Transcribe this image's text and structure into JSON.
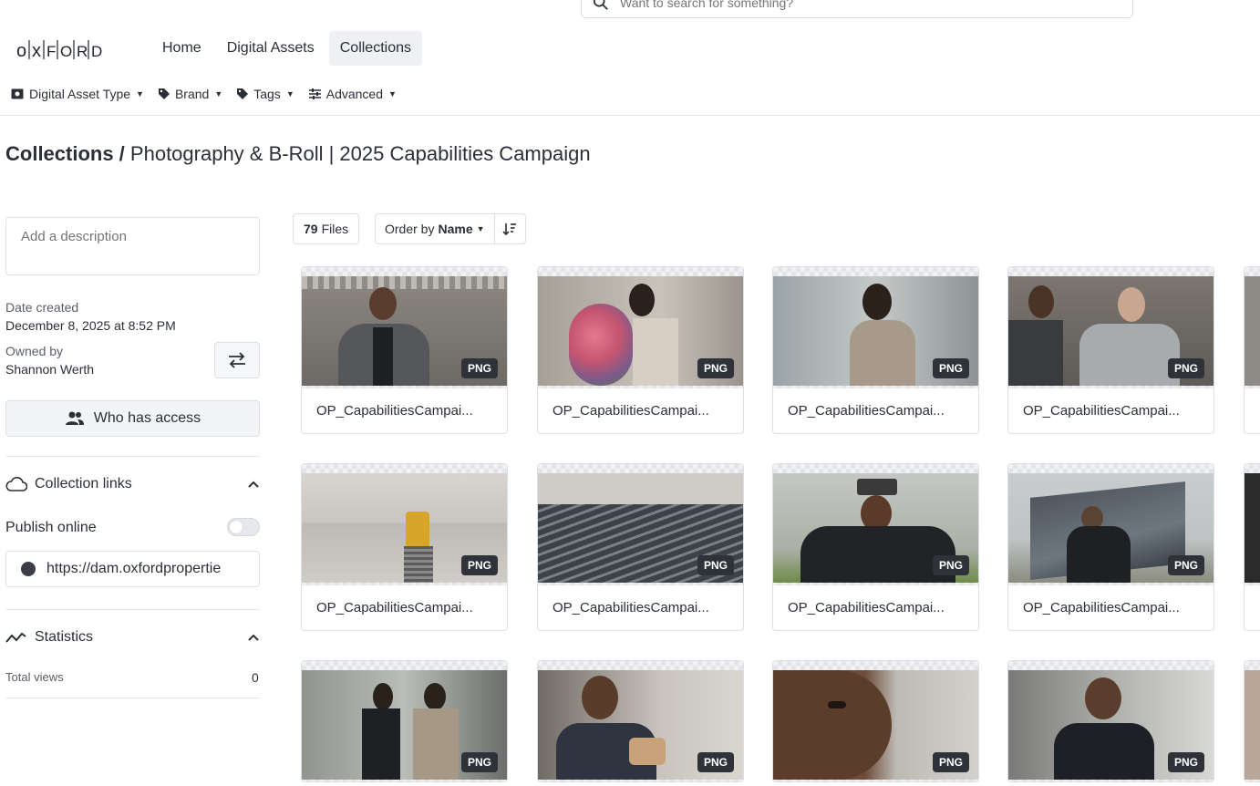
{
  "search": {
    "placeholder": "Want to search for something?"
  },
  "brand": {
    "logo_text": "OXFORD"
  },
  "nav": {
    "items": [
      {
        "label": "Home",
        "active": false
      },
      {
        "label": "Digital Assets",
        "active": false
      },
      {
        "label": "Collections",
        "active": true
      }
    ]
  },
  "filters": [
    {
      "label": "Digital Asset Type",
      "icon": "image-icon"
    },
    {
      "label": "Brand",
      "icon": "tag-icon"
    },
    {
      "label": "Tags",
      "icon": "tags-icon"
    },
    {
      "label": "Advanced",
      "icon": "sliders-icon"
    }
  ],
  "page": {
    "crumb_root": "Collections /",
    "title": "Photography & B-Roll | 2025 Capabilities Campaign"
  },
  "sidebar": {
    "description_placeholder": "Add a description",
    "date_created_label": "Date created",
    "date_created_value": "December 8, 2025 at 8:52 PM",
    "owned_by_label": "Owned by",
    "owned_by_value": "Shannon Werth",
    "who_has_access_label": "Who has access",
    "collection_links_label": "Collection links",
    "publish_online_label": "Publish online",
    "publish_online_enabled": false,
    "link_url": "https://dam.oxfordpropertie",
    "statistics_label": "Statistics",
    "total_views_label": "Total views",
    "total_views_value": "0"
  },
  "toolbar": {
    "files_count": "79",
    "files_label": "Files",
    "order_prefix": "Order by",
    "order_value": "Name"
  },
  "assets": [
    {
      "name": "OP_CapabilitiesCampai...",
      "type": "PNG"
    },
    {
      "name": "OP_CapabilitiesCampai...",
      "type": "PNG"
    },
    {
      "name": "OP_CapabilitiesCampai...",
      "type": "PNG"
    },
    {
      "name": "OP_CapabilitiesCampai...",
      "type": "PNG"
    },
    {
      "name": "OP_CapabilitiesCampai...",
      "type": "PNG"
    },
    {
      "name": "OP_CapabilitiesCampai...",
      "type": "PNG"
    },
    {
      "name": "OP_CapabilitiesCampai...",
      "type": "PNG"
    },
    {
      "name": "OP_CapabilitiesCampai...",
      "type": "PNG"
    },
    {
      "name": "",
      "type": "PNG"
    },
    {
      "name": "",
      "type": "PNG"
    },
    {
      "name": "",
      "type": "PNG"
    },
    {
      "name": "",
      "type": "PNG"
    }
  ],
  "colors": {
    "text": "#2b2f36",
    "border": "#dcdfe3",
    "badge": "#2f3339"
  }
}
